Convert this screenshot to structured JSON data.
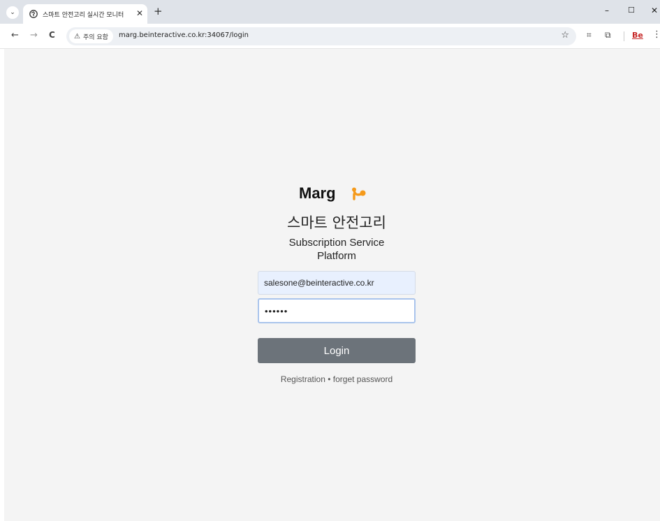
{
  "browser": {
    "tab_title": "스마트 안전고리 실시간 모니터",
    "tab_close": "✕",
    "new_tab": "+",
    "security_label": "주의 요함",
    "url": "marg.beinteractive.co.kr:34067/login",
    "window_controls": {
      "minimize": "–",
      "maximize": "☐",
      "close": "✕"
    },
    "nav": {
      "back": "←",
      "forward": "→",
      "reload": "C"
    },
    "icons": {
      "tab_menu": "chevron-down-icon",
      "favicon": "globe-icon",
      "warning": "warning-icon",
      "bookmark": "star-icon",
      "screenshot": "screen-capture-icon",
      "extensions": "puzzle-icon",
      "profile": "be-icon",
      "menu": "kebab-menu-icon"
    },
    "be_label": "Be"
  },
  "login": {
    "logo_text": "Marg",
    "title": "스마트 안전고리",
    "subtitle_line1": "Subscription Service",
    "subtitle_line2": "Platform",
    "email_value": "salesone@beinteractive.co.kr",
    "password_value": "••••••",
    "login_button": "Login",
    "registration_link": "Registration",
    "separator": "•",
    "forget_link": "forget password"
  },
  "colors": {
    "logo_accent": "#f59a1b",
    "button_bg": "#6c737a",
    "page_bg": "#f4f4f4",
    "autofill_bg": "#e8f0fe"
  }
}
